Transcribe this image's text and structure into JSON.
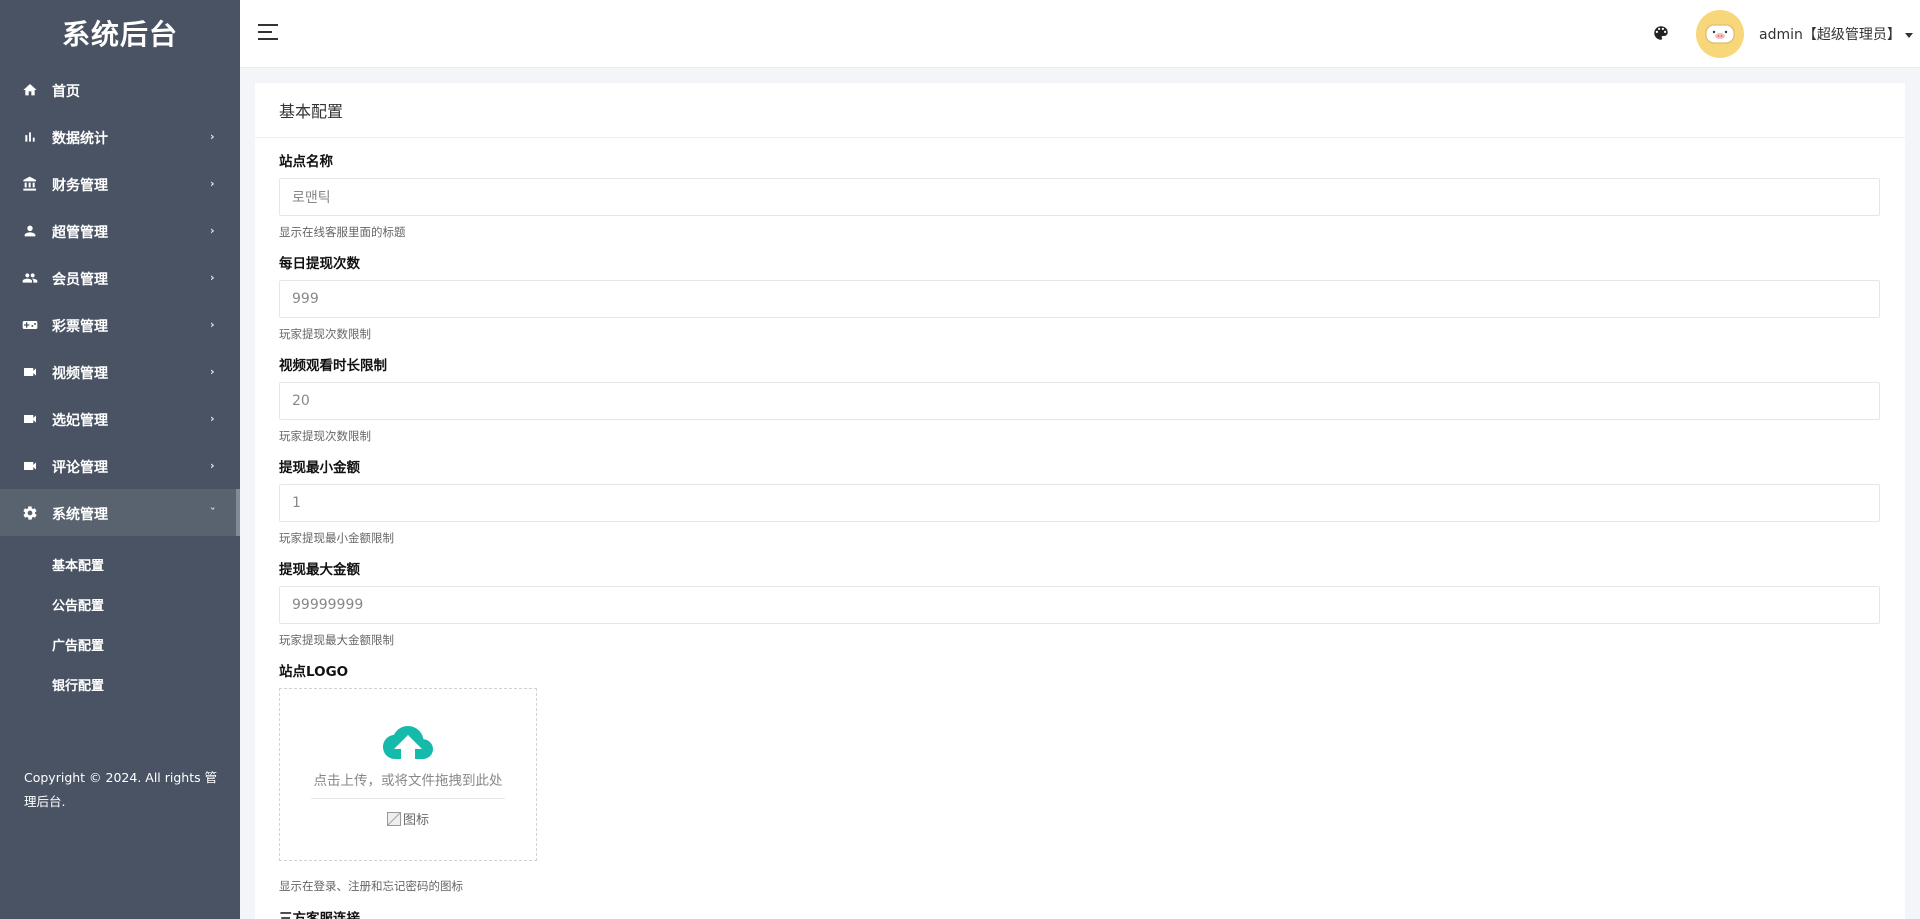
{
  "sidebar": {
    "brand": "系统后台",
    "items": [
      {
        "label": "首页",
        "icon": "home-icon"
      },
      {
        "label": "数据统计",
        "icon": "bar-chart-icon"
      },
      {
        "label": "财务管理",
        "icon": "bank-icon"
      },
      {
        "label": "超管管理",
        "icon": "person-icon"
      },
      {
        "label": "会员管理",
        "icon": "people-icon"
      },
      {
        "label": "彩票管理",
        "icon": "gamepad-icon"
      },
      {
        "label": "视频管理",
        "icon": "video-icon"
      },
      {
        "label": "选妃管理",
        "icon": "video-icon"
      },
      {
        "label": "评论管理",
        "icon": "video-icon"
      },
      {
        "label": "系统管理",
        "icon": "gear-icon"
      }
    ],
    "active_item": "系统管理",
    "sub_items": [
      "基本配置",
      "公告配置",
      "广告配置",
      "银行配置"
    ],
    "copyright": "Copyright © 2024. All rights 管理后台."
  },
  "header": {
    "user_label": "admin【超级管理员】"
  },
  "main": {
    "title": "基本配置",
    "fields": {
      "site_name": {
        "label": "站点名称",
        "value": "로맨틱",
        "help": "显示在线客服里面的标题"
      },
      "daily_withdraw": {
        "label": "每日提现次数",
        "value": "999",
        "help": "玩家提现次数限制"
      },
      "video_limit": {
        "label": "视频观看时长限制",
        "value": "20",
        "help": "玩家提现次数限制"
      },
      "min_withdraw": {
        "label": "提现最小金额",
        "value": "1",
        "help": "玩家提现最小金额限制"
      },
      "max_withdraw": {
        "label": "提现最大金额",
        "value": "99999999",
        "help": "玩家提现最大金额限制"
      },
      "site_logo": {
        "label": "站点LOGO",
        "upload_text": "点击上传，或将文件拖拽到此处",
        "image_alt": "图标",
        "help": "显示在登录、注册和忘记密码的图标"
      },
      "third_party": {
        "label": "三方客服连接"
      }
    }
  },
  "colors": {
    "sidebar_bg": "#4a5364",
    "sidebar_active_bg": "#59626f",
    "upload_accent": "#16baaa",
    "avatar_bg": "#f8d77a"
  }
}
